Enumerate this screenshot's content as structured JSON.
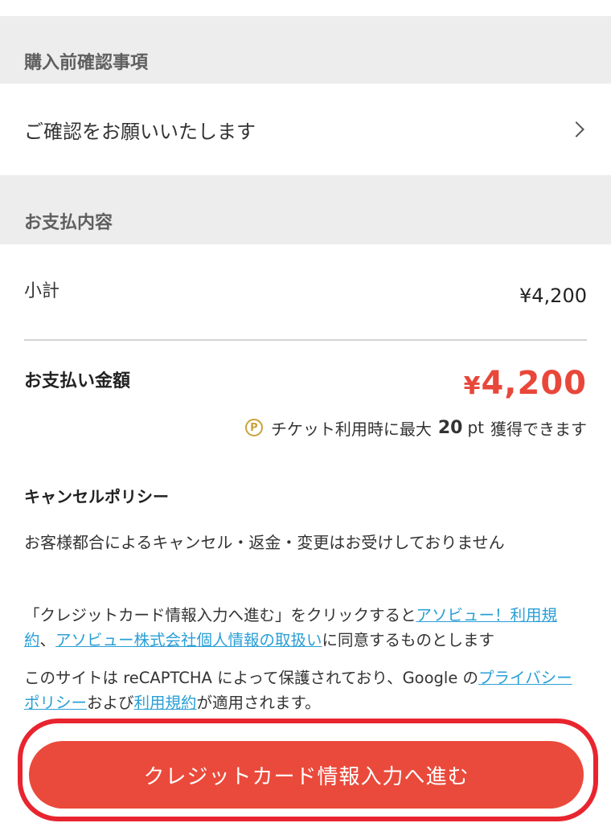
{
  "sections": {
    "pre_purchase_header": "購入前確認事項",
    "confirm_row_label": "ご確認をお願いいたします",
    "payment_header": "お支払内容"
  },
  "payment": {
    "subtotal_label": "小計",
    "subtotal_value": "¥4,200",
    "total_label": "お支払い金額",
    "total_currency": "¥",
    "total_amount": "4,200",
    "points_prefix": "チケット利用時に最大",
    "points_number": "20",
    "points_unit": "pt",
    "points_suffix": "獲得できます",
    "points_icon_letter": "P"
  },
  "cancel_policy": {
    "title": "キャンセルポリシー",
    "text": "お客様都合によるキャンセル・返金・変更はお受けしておりません"
  },
  "agreement": {
    "prefix": "「クレジットカード情報入力へ進む」をクリックすると",
    "link_terms": "アソビュー！利用規約",
    "separator": "、",
    "link_privacy": "アソビュー株式会社個人情報の取扱い",
    "suffix": "に同意するものとします"
  },
  "recaptcha": {
    "prefix": "このサイトは reCAPTCHA によって保護されており、Google の",
    "link_privacy": "プライバシーポリシー",
    "middle": "および",
    "link_terms": "利用規約",
    "suffix": "が適用されます。"
  },
  "cta": {
    "label": "クレジットカード情報入力へ進む"
  },
  "colors": {
    "accent": "#ea4a3b",
    "total_price": "#e8473a",
    "link": "#2a9fd6",
    "annotation": "#e8252f",
    "section_bg": "#ededed",
    "points_icon": "#c9a23a"
  },
  "icons": {
    "chevron": "chevron-right-icon",
    "points": "points-p-icon"
  }
}
